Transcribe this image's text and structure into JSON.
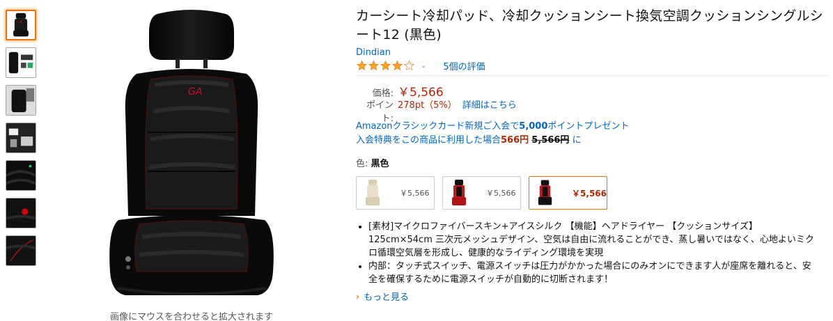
{
  "gallery": {
    "thumbnails": [
      {
        "name": "thumb-seat-front",
        "active": true
      },
      {
        "name": "thumb-seat-accessories",
        "active": false
      },
      {
        "name": "thumb-seat-installed",
        "active": false
      },
      {
        "name": "thumb-seat-parts",
        "active": false
      },
      {
        "name": "thumb-fabric-closeup",
        "active": false
      },
      {
        "name": "thumb-logo-closeup",
        "active": false
      },
      {
        "name": "thumb-stitching-closeup",
        "active": false
      }
    ],
    "zoom_hint": "画像にマウスを合わせると拡大されます"
  },
  "product": {
    "title": "カーシート冷却パッド、冷却クッションシート換気空調クッションシングルシート12 (黒色)",
    "brand": "Dindian",
    "rating": 4,
    "rating_max": 5,
    "reviews": "5個の評価"
  },
  "pricing": {
    "price_label": "価格:",
    "price": "￥5,566",
    "points_label": "ポイント:",
    "points": "278pt（5%）",
    "points_link": "詳細はこちら"
  },
  "promo": {
    "line1_prefix": "Amazonクラシックカード新規ご入会で",
    "line1_bold": "5,000",
    "line1_suffix": "ポイントプレゼント",
    "line2_prefix": "入会特典をこの商品に利用した場合",
    "line2_price": "566円",
    "line2_strike": "5,566円",
    "line2_suffix": "に"
  },
  "color": {
    "label": "色:",
    "value": "黒色",
    "options": [
      {
        "price": "￥5,566",
        "variant": "beige"
      },
      {
        "price": "￥5,566",
        "variant": "red"
      },
      {
        "price": "￥5,566",
        "variant": "black"
      }
    ]
  },
  "features": [
    "[素材]マイクロファイバースキン+アイスシルク 【機能】ヘアドライヤー 【クッションサイズ】125cm×54cm 三次元メッシュデザイン、空気は自由に流れることができ、蒸し暑いではなく、心地よいミクロ循環空気層を形成し、健康的なライディング環境を実現",
    "内部：タッチ式スイッチ、電源スイッチは圧力がかかった場合にのみオンにできます人が座席を離れると、安全を確保するために電源スイッチが自動的に切断されます！"
  ],
  "more_link": "もっと見る",
  "colors": {
    "link": "#0066c0",
    "price": "#b12704",
    "star": "#ffa41c",
    "selected_border": "#e77600"
  }
}
